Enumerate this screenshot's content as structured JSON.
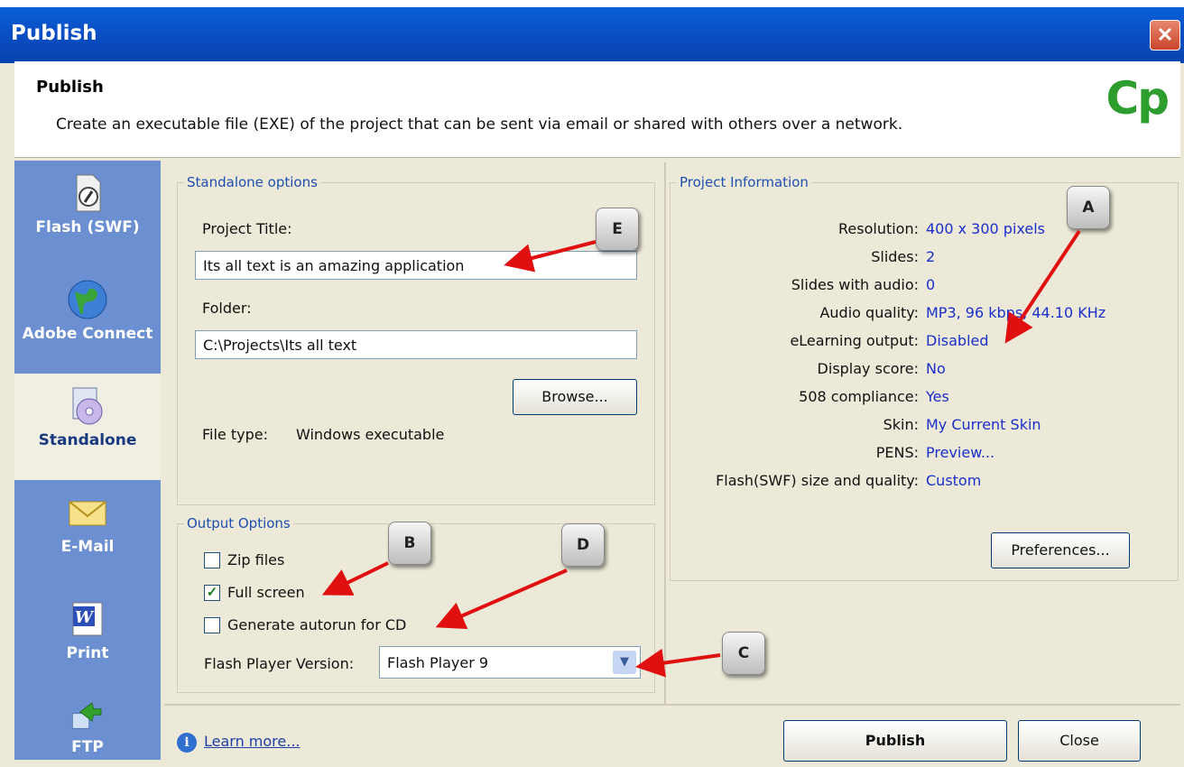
{
  "window": {
    "title": "Publish",
    "close_glyph": "✕"
  },
  "header": {
    "title": "Publish",
    "description": "Create an executable file (EXE) of the project that can be sent via email or shared with others over a network.",
    "logo_text": "Cp"
  },
  "sidebar": {
    "items": [
      {
        "label": "Flash (SWF)",
        "icon": "flash-document-icon"
      },
      {
        "label": "Adobe Connect",
        "icon": "globe-icon"
      },
      {
        "label": "Standalone",
        "icon": "cd-icon"
      },
      {
        "label": "E-Mail",
        "icon": "envelope-icon"
      },
      {
        "label": "Print",
        "icon": "word-document-icon"
      },
      {
        "label": "FTP",
        "icon": "ftp-transfer-icon"
      }
    ]
  },
  "standalone": {
    "group_label": "Standalone options",
    "project_title_label": "Project Title:",
    "project_title_value": "Its all text is an amazing application",
    "folder_label": "Folder:",
    "folder_value": "C:\\Projects\\Its all text",
    "browse_label": "Browse...",
    "file_type_label": "File type:",
    "file_type_value": "Windows executable"
  },
  "output": {
    "group_label": "Output Options",
    "zip_label": "Zip files",
    "zip_checked": false,
    "fullscreen_label": "Full screen",
    "fullscreen_checked": true,
    "autorun_label": "Generate autorun for CD",
    "autorun_checked": false,
    "flash_version_label": "Flash Player Version:",
    "flash_version_value": "Flash Player 9"
  },
  "project_info": {
    "group_label": "Project Information",
    "rows": [
      {
        "key": "Resolution:",
        "value": "400 x 300 pixels"
      },
      {
        "key": "Slides:",
        "value": "2"
      },
      {
        "key": "Slides with audio:",
        "value": "0"
      },
      {
        "key": "Audio quality:",
        "value": "MP3, 96 kbps, 44.10 KHz"
      },
      {
        "key": "eLearning output:",
        "value": "Disabled"
      },
      {
        "key": "Display score:",
        "value": "No"
      },
      {
        "key": "508 compliance:",
        "value": "Yes"
      },
      {
        "key": "Skin:",
        "value": "My Current Skin"
      },
      {
        "key": "PENS:",
        "value": "Preview..."
      },
      {
        "key": "Flash(SWF) size and quality:",
        "value": "Custom"
      }
    ],
    "preferences_label": "Preferences..."
  },
  "footer": {
    "learn_more": "Learn more...",
    "publish_label": "Publish",
    "close_label": "Close"
  },
  "callouts": {
    "a": "A",
    "b": "B",
    "c": "C",
    "d": "D",
    "e": "E"
  },
  "colors": {
    "titlebar": "#0a4fc4",
    "sidebar": "#6b8fd1",
    "dialog_bg": "#ece9d8",
    "info_value": "#1a2fcc",
    "arrow": "#e01010",
    "logo": "#2d9d2d"
  }
}
